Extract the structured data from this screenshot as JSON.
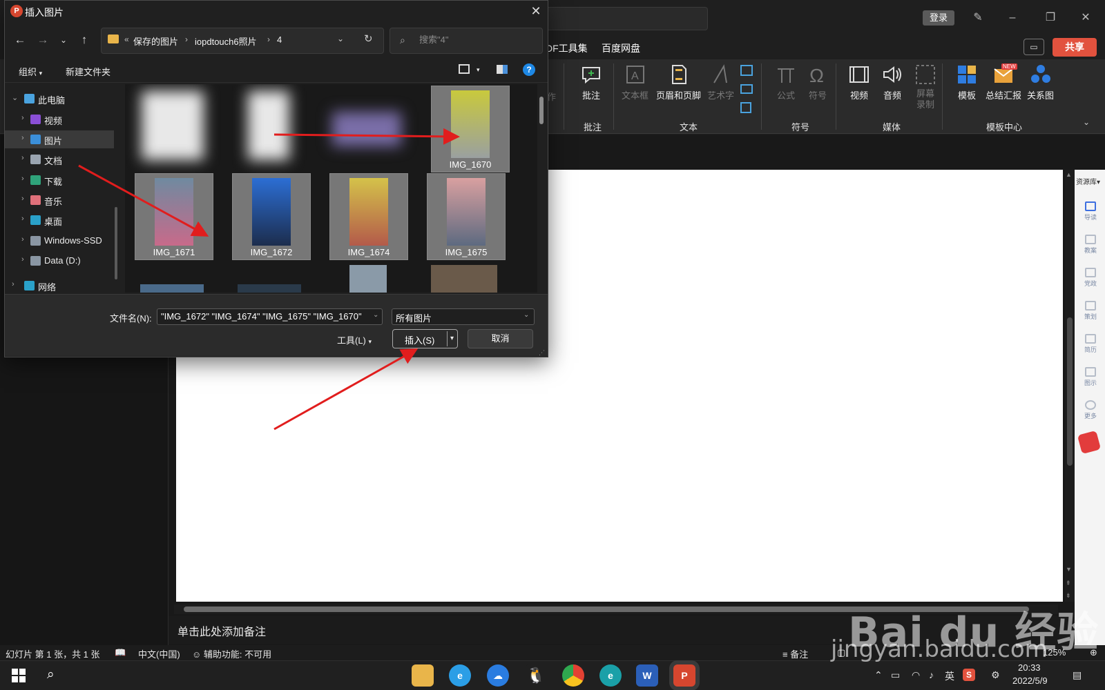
{
  "app": {
    "login_label": "登录",
    "menu_tabs": [
      "DF工具集",
      "百度网盘"
    ],
    "share_label": "共享",
    "ribbon": {
      "items": [
        {
          "label": "作",
          "dim": true
        },
        {
          "label": "批注",
          "dim": false
        },
        {
          "label": "文本框",
          "dim": true
        },
        {
          "label": "页眉和页脚",
          "dim": false
        },
        {
          "label": "艺术字",
          "dim": true
        },
        {
          "label": "公式",
          "dim": true
        },
        {
          "label": "符号",
          "dim": true
        },
        {
          "label": "视频",
          "dim": false
        },
        {
          "label": "音频",
          "dim": false
        },
        {
          "label": "屏幕录制",
          "dim": true
        },
        {
          "label": "模板",
          "dim": false
        },
        {
          "label": "总结汇报",
          "dim": false
        },
        {
          "label": "关系图",
          "dim": false
        }
      ],
      "new_badge": "NEW",
      "groups": [
        "批注",
        "文本",
        "符号",
        "媒体",
        "模板中心"
      ]
    },
    "notes_placeholder": "单击此处添加备注",
    "sidebar": {
      "title": "资源库",
      "items": [
        "导读",
        "教案",
        "党政",
        "策划",
        "简历",
        "图示",
        "更多"
      ]
    },
    "status": {
      "slide_info": "幻灯片 第 1 张，共 1 张",
      "language": "中文(中国)",
      "accessibility": "辅助功能: 不可用",
      "notes_label": "备注",
      "zoom": "125%"
    },
    "taskbar": {
      "tray_lang": "英",
      "time": "20:33",
      "date": "2022/5/9"
    }
  },
  "dialog": {
    "title": "插入图片",
    "breadcrumbs": [
      "保存的图片",
      "iopdtouch6照片",
      "4"
    ],
    "search_placeholder": "搜索\"4\"",
    "commands": {
      "organize": "组织",
      "new_folder": "新建文件夹"
    },
    "nav_tree": [
      {
        "label": "此电脑",
        "icon": "computer-icon",
        "color": "#4aa3df"
      },
      {
        "label": "视频",
        "icon": "video-folder-icon",
        "color": "#8a4fd6"
      },
      {
        "label": "图片",
        "icon": "pictures-folder-icon",
        "color": "#3b8fd9",
        "selected": true
      },
      {
        "label": "文档",
        "icon": "documents-folder-icon",
        "color": "#9aa4b0"
      },
      {
        "label": "下载",
        "icon": "downloads-folder-icon",
        "color": "#2fa37a"
      },
      {
        "label": "音乐",
        "icon": "music-folder-icon",
        "color": "#e0707a"
      },
      {
        "label": "桌面",
        "icon": "desktop-folder-icon",
        "color": "#2aa1c9"
      },
      {
        "label": "Windows-SSD",
        "icon": "drive-icon",
        "color": "#8a96a3"
      },
      {
        "label": "Data (D:)",
        "icon": "drive-icon",
        "color": "#8a96a3"
      },
      {
        "label": "网络",
        "icon": "network-icon",
        "color": "#2aa1c9"
      }
    ],
    "files": [
      {
        "name": "IMG_1670",
        "selected": true,
        "colors": [
          "#c9c93c",
          "#9aa0a0"
        ]
      },
      {
        "name": "IMG_1671",
        "selected": true,
        "colors": [
          "#6f8aa0",
          "#c86a8a"
        ]
      },
      {
        "name": "IMG_1672",
        "selected": true,
        "colors": [
          "#2c6ed4",
          "#1c2d4d"
        ]
      },
      {
        "name": "IMG_1674",
        "selected": true,
        "colors": [
          "#d4c24a",
          "#b35a4a"
        ]
      },
      {
        "name": "IMG_1675",
        "selected": true,
        "colors": [
          "#d9a0a0",
          "#5d6a80"
        ]
      }
    ],
    "filename_label": "文件名(N):",
    "filename_value": "\"IMG_1672\" \"IMG_1674\" \"IMG_1675\" \"IMG_1670\"",
    "file_type": "所有图片",
    "tools_label": "工具(L)",
    "insert_label": "插入(S)",
    "cancel_label": "取消"
  },
  "watermark": {
    "brand": "Bai du 经验",
    "url": "jingyan.baidu.com"
  }
}
